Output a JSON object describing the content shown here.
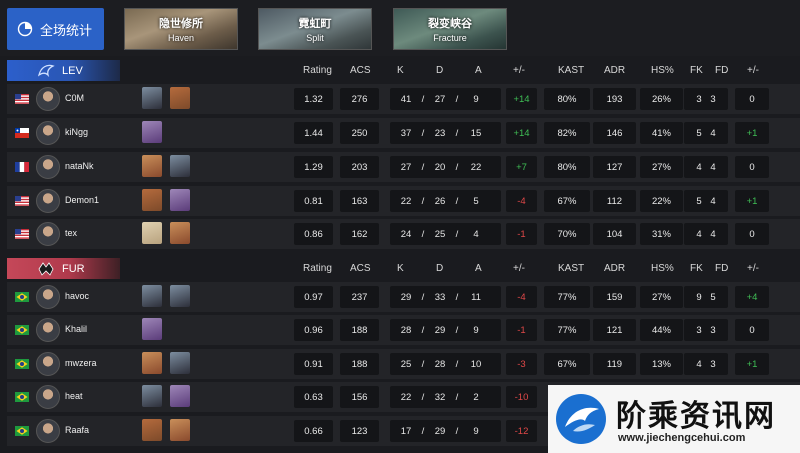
{
  "stats_button": {
    "label": "全场统计"
  },
  "maps": [
    {
      "cn": "隐世修所",
      "en": "Haven"
    },
    {
      "cn": "霓虹町",
      "en": "Split"
    },
    {
      "cn": "裂变峡谷",
      "en": "Fracture"
    }
  ],
  "headers": [
    "Rating",
    "ACS",
    "K",
    "D",
    "A",
    "+/-",
    "KAST",
    "ADR",
    "HS%",
    "FK",
    "FD",
    "+/-"
  ],
  "kda_sep": "/",
  "teams": [
    {
      "name": "LEV",
      "color": "#2c5fcb",
      "players": [
        {
          "name": "C0M",
          "flag": "US",
          "rating": "1.32",
          "acs": "276",
          "k": "41",
          "d": "27",
          "a": "9",
          "pm": "+14",
          "kast": "80%",
          "adr": "193",
          "hs": "26%",
          "fk": "3",
          "fd": "3",
          "fpm": "0"
        },
        {
          "name": "kiNgg",
          "flag": "CL",
          "rating": "1.44",
          "acs": "250",
          "k": "37",
          "d": "23",
          "a": "15",
          "pm": "+14",
          "kast": "82%",
          "adr": "146",
          "hs": "41%",
          "fk": "5",
          "fd": "4",
          "fpm": "+1"
        },
        {
          "name": "nataNk",
          "flag": "FR",
          "rating": "1.29",
          "acs": "203",
          "k": "27",
          "d": "20",
          "a": "22",
          "pm": "+7",
          "kast": "80%",
          "adr": "127",
          "hs": "27%",
          "fk": "4",
          "fd": "4",
          "fpm": "0"
        },
        {
          "name": "Demon1",
          "flag": "US",
          "rating": "0.81",
          "acs": "163",
          "k": "22",
          "d": "26",
          "a": "5",
          "pm": "-4",
          "kast": "67%",
          "adr": "112",
          "hs": "22%",
          "fk": "5",
          "fd": "4",
          "fpm": "+1"
        },
        {
          "name": "tex",
          "flag": "US",
          "rating": "0.86",
          "acs": "162",
          "k": "24",
          "d": "25",
          "a": "4",
          "pm": "-1",
          "kast": "70%",
          "adr": "104",
          "hs": "31%",
          "fk": "4",
          "fd": "4",
          "fpm": "0"
        }
      ]
    },
    {
      "name": "FUR",
      "color": "#c54859",
      "players": [
        {
          "name": "havoc",
          "flag": "BR",
          "rating": "0.97",
          "acs": "237",
          "k": "29",
          "d": "33",
          "a": "11",
          "pm": "-4",
          "kast": "77%",
          "adr": "159",
          "hs": "27%",
          "fk": "9",
          "fd": "5",
          "fpm": "+4"
        },
        {
          "name": "Khalil",
          "flag": "BR",
          "rating": "0.96",
          "acs": "188",
          "k": "28",
          "d": "29",
          "a": "9",
          "pm": "-1",
          "kast": "77%",
          "adr": "121",
          "hs": "44%",
          "fk": "3",
          "fd": "3",
          "fpm": "0"
        },
        {
          "name": "mwzera",
          "flag": "BR",
          "rating": "0.91",
          "acs": "188",
          "k": "25",
          "d": "28",
          "a": "10",
          "pm": "-3",
          "kast": "67%",
          "adr": "119",
          "hs": "13%",
          "fk": "4",
          "fd": "3",
          "fpm": "+1"
        },
        {
          "name": "heat",
          "flag": "BR",
          "rating": "0.63",
          "acs": "156",
          "k": "22",
          "d": "32",
          "a": "2",
          "pm": "-10",
          "kast": "",
          "adr": "",
          "hs": "",
          "fk": "",
          "fd": "",
          "fpm": ""
        },
        {
          "name": "Raafa",
          "flag": "BR",
          "rating": "0.66",
          "acs": "123",
          "k": "17",
          "d": "29",
          "a": "9",
          "pm": "-12",
          "kast": "",
          "adr": "",
          "hs": "",
          "fk": "",
          "fd": "",
          "fpm": ""
        }
      ]
    }
  ],
  "watermark": {
    "cn": "阶乘资讯网",
    "url": "www.jiechengcehui.com"
  }
}
